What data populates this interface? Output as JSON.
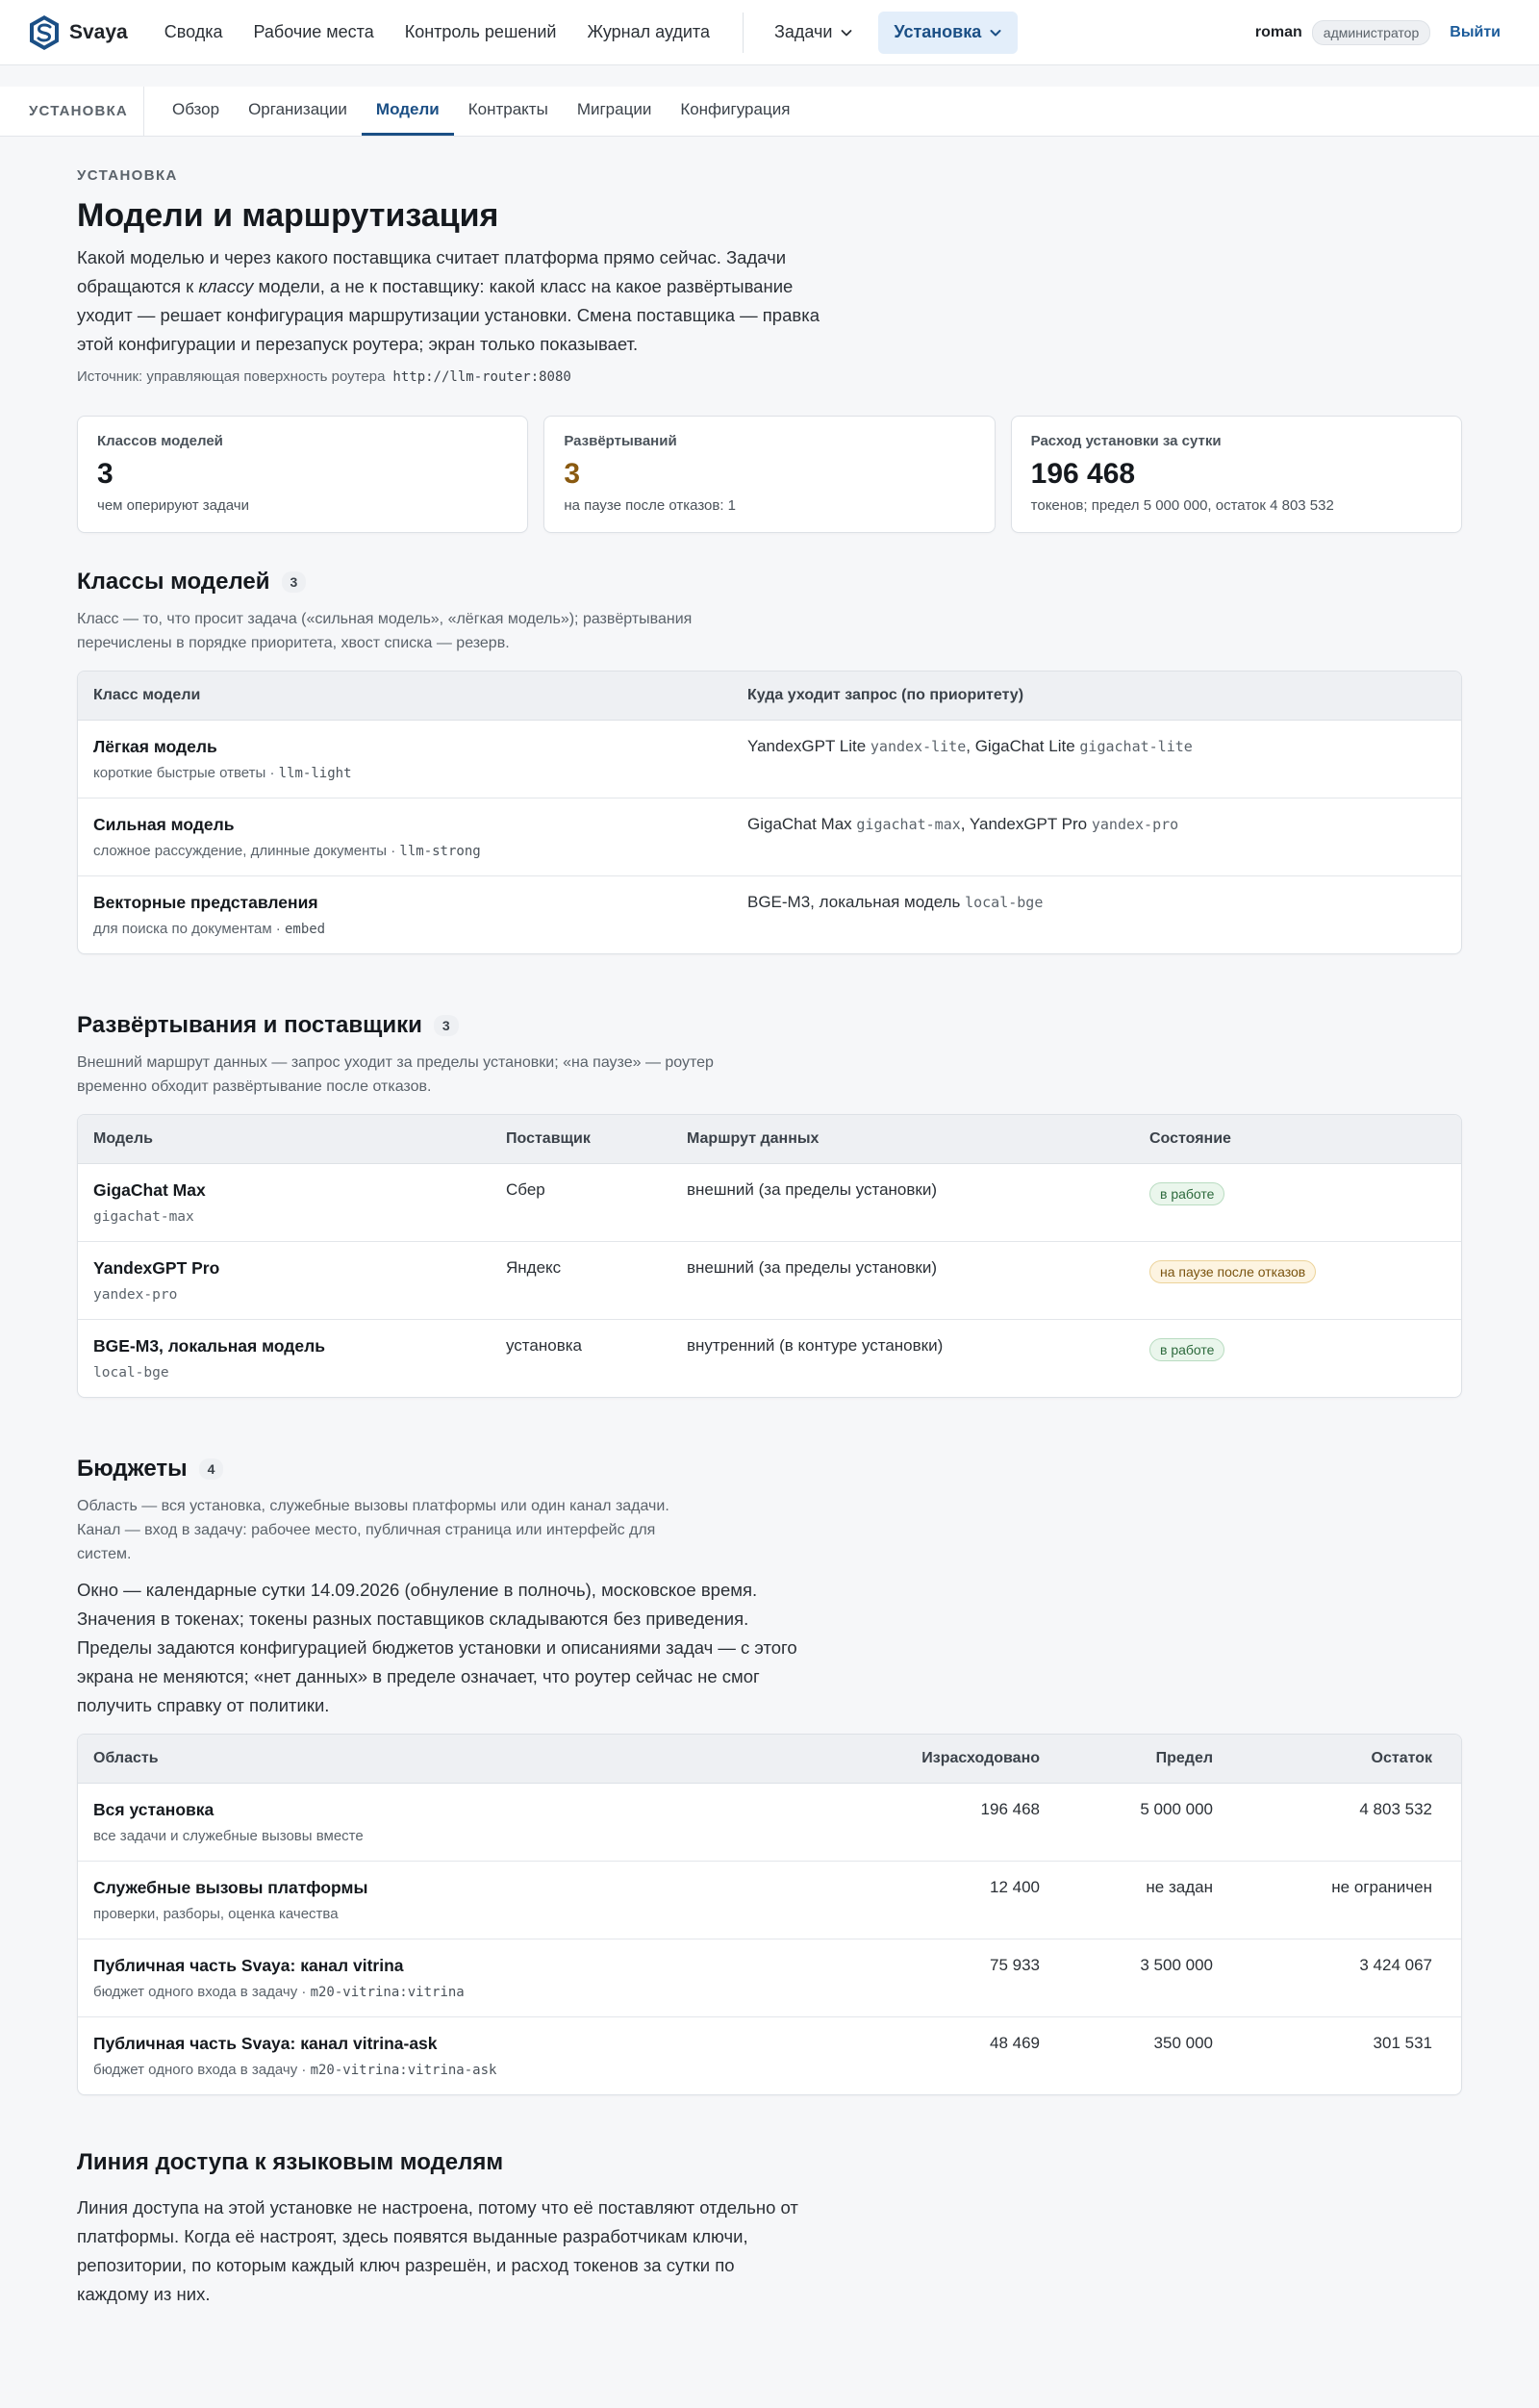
{
  "brand": {
    "name": "Svaya"
  },
  "nav": {
    "items": [
      "Сводка",
      "Рабочие места",
      "Контроль решений",
      "Журнал аудита"
    ],
    "tasks": "Задачи",
    "active": "Установка",
    "user": "roman",
    "role": "администратор",
    "logout": "Выйти"
  },
  "subnav": {
    "section": "УСТАНОВКА",
    "tabs": [
      "Обзор",
      "Организации",
      "Модели",
      "Контракты",
      "Миграции",
      "Конфигурация"
    ],
    "active_tab": "Модели"
  },
  "page": {
    "eyebrow": "УСТАНОВКА",
    "title": "Модели и маршрутизация",
    "lead_1": "Какой моделью и через какого поставщика считает платформа прямо сейчас. Задачи обращаются к ",
    "lead_em": "классу",
    "lead_2": " модели, а не к поставщику: какой класс на какое развёртывание уходит — решает конфигурация маршрутизации установки. Смена поставщика — правка этой конфигурации и перезапуск роутера; экран только показывает.",
    "source_label": "Источник: управляющая поверхность роутера",
    "source_url": "http://llm-router:8080"
  },
  "stats": [
    {
      "label": "Классов моделей",
      "value": "3",
      "note": "чем оперируют задачи"
    },
    {
      "label": "Развёртываний",
      "value": "3",
      "note": "на паузе после отказов: 1"
    },
    {
      "label": "Расход установки за сутки",
      "value": "196 468",
      "note": "токенов; предел 5 000 000, остаток 4 803 532"
    }
  ],
  "classes": {
    "title": "Классы моделей",
    "count": "3",
    "desc": "Класс — то, что просит задача («сильная модель», «лёгкая модель»); развёртывания перечислены в порядке приоритета, хвост списка — резерв.",
    "headers": [
      "Класс модели",
      "Куда уходит запрос (по приоритету)"
    ],
    "rows": [
      {
        "name": "Лёгкая модель",
        "sub": "короткие быстрые ответы · ",
        "code": "llm-light",
        "targets": [
          {
            "name": "YandexGPT Lite",
            "code": "yandex-lite",
            "sep": ", "
          },
          {
            "name": "GigaChat Lite",
            "code": "gigachat-lite",
            "sep": ""
          }
        ]
      },
      {
        "name": "Сильная модель",
        "sub": "сложное рассуждение, длинные документы · ",
        "code": "llm-strong",
        "targets": [
          {
            "name": "GigaChat Max",
            "code": "gigachat-max",
            "sep": ", "
          },
          {
            "name": "YandexGPT Pro",
            "code": "yandex-pro",
            "sep": ""
          }
        ]
      },
      {
        "name": "Векторные представления",
        "sub": "для поиска по документам · ",
        "code": "embed",
        "targets": [
          {
            "name": "BGE-M3, локальная модель",
            "code": "local-bge",
            "sep": ""
          }
        ]
      }
    ]
  },
  "deployments": {
    "title": "Развёртывания и поставщики",
    "count": "3",
    "desc": "Внешний маршрут данных — запрос уходит за пределы установки; «на паузе» — роутер временно обходит развёртывание после отказов.",
    "headers": [
      "Модель",
      "Поставщик",
      "Маршрут данных",
      "Состояние"
    ],
    "rows": [
      {
        "name": "GigaChat Max",
        "code": "gigachat-max",
        "provider": "Сбер",
        "route": "внешний (за пределы установки)",
        "state": "в работе",
        "state_kind": "ok"
      },
      {
        "name": "YandexGPT Pro",
        "code": "yandex-pro",
        "provider": "Яндекс",
        "route": "внешний (за пределы установки)",
        "state": "на паузе после отказов",
        "state_kind": "pause"
      },
      {
        "name": "BGE-M3, локальная модель",
        "code": "local-bge",
        "provider": "установка",
        "route": "внутренний (в контуре установки)",
        "state": "в работе",
        "state_kind": "ok"
      }
    ]
  },
  "budgets": {
    "title": "Бюджеты",
    "count": "4",
    "desc": "Область — вся установка, служебные вызовы платформы или один канал задачи. Канал — вход в задачу: рабочее место, публичная страница или интерфейс для систем.",
    "para": "Окно — календарные сутки 14.09.2026 (обнуление в полночь), московское время. Значения в токенах; токены разных поставщиков складываются без приведения. Пределы задаются конфигурацией бюджетов установки и описаниями задач — с этого экрана не меняются; «нет данных» в пределе означает, что роутер сейчас не смог получить справку от политики.",
    "headers": [
      "Область",
      "Израсходовано",
      "Предел",
      "Остаток"
    ],
    "rows": [
      {
        "name": "Вся установка",
        "sub": "все задачи и служебные вызовы вместе",
        "code": "",
        "spent": "196 468",
        "limit": "5 000 000",
        "left": "4 803 532"
      },
      {
        "name": "Служебные вызовы платформы",
        "sub": "проверки, разборы, оценка качества",
        "code": "",
        "spent": "12 400",
        "limit": "не задан",
        "left": "не ограничен"
      },
      {
        "name": "Публичная часть Svaya: канал vitrina",
        "sub": "бюджет одного входа в задачу · ",
        "code": "m20-vitrina:vitrina",
        "spent": "75 933",
        "limit": "3 500 000",
        "left": "3 424 067"
      },
      {
        "name": "Публичная часть Svaya: канал vitrina-ask",
        "sub": "бюджет одного входа в задачу · ",
        "code": "m20-vitrina:vitrina-ask",
        "spent": "48 469",
        "limit": "350 000",
        "left": "301 531"
      }
    ]
  },
  "access": {
    "title": "Линия доступа к языковым моделям",
    "para": "Линия доступа на этой установке не настроена, потому что её поставляют отдельно от платформы. Когда её настроят, здесь появятся выданные разработчикам ключи, репозитории, по которым каждый ключ разрешён, и расход токенов за сутки по каждому из них."
  }
}
